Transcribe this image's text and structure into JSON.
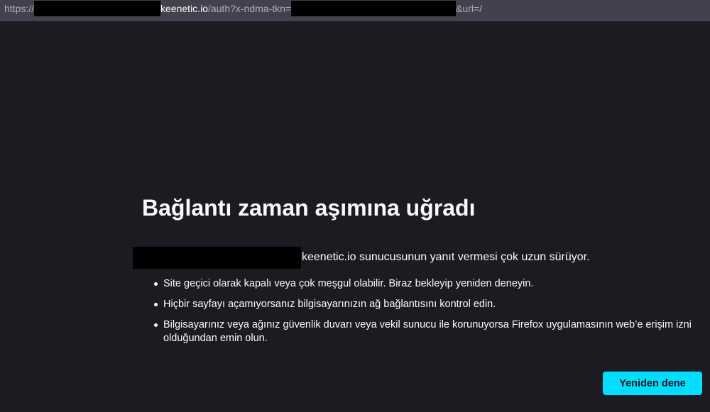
{
  "urlbar": {
    "scheme": "https://",
    "host": "keenetic.io",
    "path": "/auth?x-ndma-tkn=",
    "suffix": "&url=/"
  },
  "error": {
    "title": "Bağlantı zaman aşımına uğradı",
    "description": "keenetic.io sunucusunun yanıt vermesi çok uzun sürüyor.",
    "tips": [
      "Site geçici olarak kapalı veya çok meşgul olabilir. Biraz bekleyip yeniden deneyin.",
      "Hiçbir sayfayı açamıyorsanız bilgisayarınızın ağ bağlantısını kontrol edin.",
      "Bilgisayarınız veya ağınız güvenlik duvarı veya vekil sunucu ile korunuyorsa Firefox uygulamasının web’e erişim izni olduğundan emin olun."
    ],
    "retry_label": "Yeniden dene"
  },
  "colors": {
    "background": "#1c1b22",
    "urlbar": "#42414d",
    "accent": "#00ddff",
    "redaction": "#000000"
  }
}
